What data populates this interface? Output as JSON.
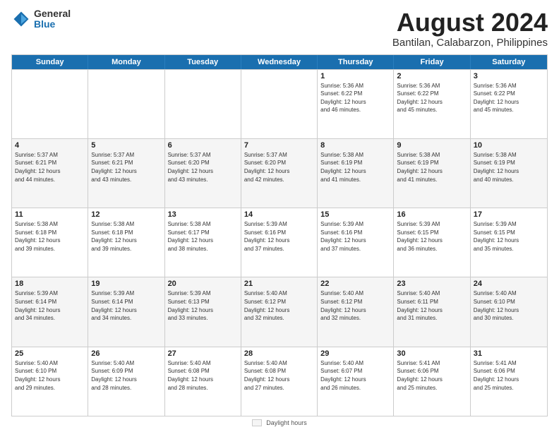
{
  "logo": {
    "general": "General",
    "blue": "Blue"
  },
  "title": "August 2024",
  "subtitle": "Bantilan, Calabarzon, Philippines",
  "days_of_week": [
    "Sunday",
    "Monday",
    "Tuesday",
    "Wednesday",
    "Thursday",
    "Friday",
    "Saturday"
  ],
  "weeks": [
    [
      {
        "day": "",
        "info": ""
      },
      {
        "day": "",
        "info": ""
      },
      {
        "day": "",
        "info": ""
      },
      {
        "day": "",
        "info": ""
      },
      {
        "day": "1",
        "info": "Sunrise: 5:36 AM\nSunset: 6:22 PM\nDaylight: 12 hours\nand 46 minutes."
      },
      {
        "day": "2",
        "info": "Sunrise: 5:36 AM\nSunset: 6:22 PM\nDaylight: 12 hours\nand 45 minutes."
      },
      {
        "day": "3",
        "info": "Sunrise: 5:36 AM\nSunset: 6:22 PM\nDaylight: 12 hours\nand 45 minutes."
      }
    ],
    [
      {
        "day": "4",
        "info": "Sunrise: 5:37 AM\nSunset: 6:21 PM\nDaylight: 12 hours\nand 44 minutes."
      },
      {
        "day": "5",
        "info": "Sunrise: 5:37 AM\nSunset: 6:21 PM\nDaylight: 12 hours\nand 43 minutes."
      },
      {
        "day": "6",
        "info": "Sunrise: 5:37 AM\nSunset: 6:20 PM\nDaylight: 12 hours\nand 43 minutes."
      },
      {
        "day": "7",
        "info": "Sunrise: 5:37 AM\nSunset: 6:20 PM\nDaylight: 12 hours\nand 42 minutes."
      },
      {
        "day": "8",
        "info": "Sunrise: 5:38 AM\nSunset: 6:19 PM\nDaylight: 12 hours\nand 41 minutes."
      },
      {
        "day": "9",
        "info": "Sunrise: 5:38 AM\nSunset: 6:19 PM\nDaylight: 12 hours\nand 41 minutes."
      },
      {
        "day": "10",
        "info": "Sunrise: 5:38 AM\nSunset: 6:19 PM\nDaylight: 12 hours\nand 40 minutes."
      }
    ],
    [
      {
        "day": "11",
        "info": "Sunrise: 5:38 AM\nSunset: 6:18 PM\nDaylight: 12 hours\nand 39 minutes."
      },
      {
        "day": "12",
        "info": "Sunrise: 5:38 AM\nSunset: 6:18 PM\nDaylight: 12 hours\nand 39 minutes."
      },
      {
        "day": "13",
        "info": "Sunrise: 5:38 AM\nSunset: 6:17 PM\nDaylight: 12 hours\nand 38 minutes."
      },
      {
        "day": "14",
        "info": "Sunrise: 5:39 AM\nSunset: 6:16 PM\nDaylight: 12 hours\nand 37 minutes."
      },
      {
        "day": "15",
        "info": "Sunrise: 5:39 AM\nSunset: 6:16 PM\nDaylight: 12 hours\nand 37 minutes."
      },
      {
        "day": "16",
        "info": "Sunrise: 5:39 AM\nSunset: 6:15 PM\nDaylight: 12 hours\nand 36 minutes."
      },
      {
        "day": "17",
        "info": "Sunrise: 5:39 AM\nSunset: 6:15 PM\nDaylight: 12 hours\nand 35 minutes."
      }
    ],
    [
      {
        "day": "18",
        "info": "Sunrise: 5:39 AM\nSunset: 6:14 PM\nDaylight: 12 hours\nand 34 minutes."
      },
      {
        "day": "19",
        "info": "Sunrise: 5:39 AM\nSunset: 6:14 PM\nDaylight: 12 hours\nand 34 minutes."
      },
      {
        "day": "20",
        "info": "Sunrise: 5:39 AM\nSunset: 6:13 PM\nDaylight: 12 hours\nand 33 minutes."
      },
      {
        "day": "21",
        "info": "Sunrise: 5:40 AM\nSunset: 6:12 PM\nDaylight: 12 hours\nand 32 minutes."
      },
      {
        "day": "22",
        "info": "Sunrise: 5:40 AM\nSunset: 6:12 PM\nDaylight: 12 hours\nand 32 minutes."
      },
      {
        "day": "23",
        "info": "Sunrise: 5:40 AM\nSunset: 6:11 PM\nDaylight: 12 hours\nand 31 minutes."
      },
      {
        "day": "24",
        "info": "Sunrise: 5:40 AM\nSunset: 6:10 PM\nDaylight: 12 hours\nand 30 minutes."
      }
    ],
    [
      {
        "day": "25",
        "info": "Sunrise: 5:40 AM\nSunset: 6:10 PM\nDaylight: 12 hours\nand 29 minutes."
      },
      {
        "day": "26",
        "info": "Sunrise: 5:40 AM\nSunset: 6:09 PM\nDaylight: 12 hours\nand 28 minutes."
      },
      {
        "day": "27",
        "info": "Sunrise: 5:40 AM\nSunset: 6:08 PM\nDaylight: 12 hours\nand 28 minutes."
      },
      {
        "day": "28",
        "info": "Sunrise: 5:40 AM\nSunset: 6:08 PM\nDaylight: 12 hours\nand 27 minutes."
      },
      {
        "day": "29",
        "info": "Sunrise: 5:40 AM\nSunset: 6:07 PM\nDaylight: 12 hours\nand 26 minutes."
      },
      {
        "day": "30",
        "info": "Sunrise: 5:41 AM\nSunset: 6:06 PM\nDaylight: 12 hours\nand 25 minutes."
      },
      {
        "day": "31",
        "info": "Sunrise: 5:41 AM\nSunset: 6:06 PM\nDaylight: 12 hours\nand 25 minutes."
      }
    ]
  ],
  "legend": {
    "shaded_label": "Daylight hours"
  }
}
